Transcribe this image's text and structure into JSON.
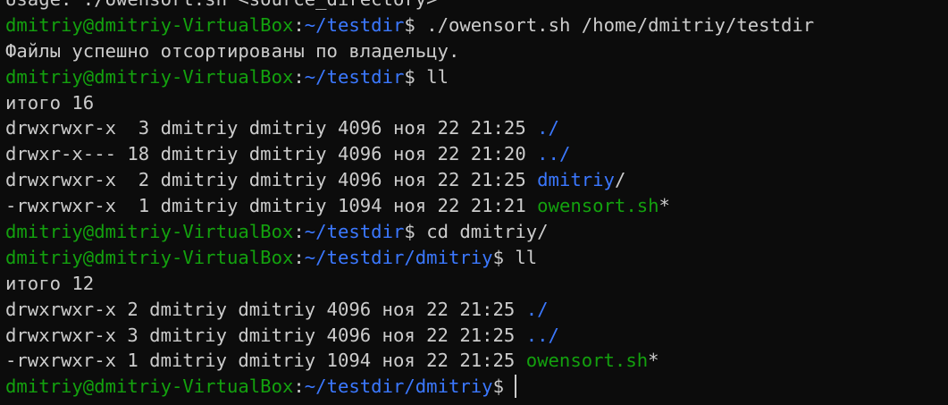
{
  "terminal": {
    "lines": [
      {
        "kind": "output",
        "text": "Usage: ./owensort.sh <source_directory>"
      },
      {
        "kind": "prompt",
        "user": "dmitriy@dmitriy-VirtualBox",
        "sep": ":",
        "path": "~/testdir",
        "dollar": "$ ",
        "command": "./owensort.sh /home/dmitriy/testdir"
      },
      {
        "kind": "output",
        "text": "Файлы успешно отсортированы по владельцу."
      },
      {
        "kind": "prompt",
        "user": "dmitriy@dmitriy-VirtualBox",
        "sep": ":",
        "path": "~/testdir",
        "dollar": "$ ",
        "command": "ll"
      },
      {
        "kind": "output",
        "text": "итого 16"
      },
      {
        "kind": "listing",
        "prefix": "drwxrwxr-x  3 dmitriy dmitriy 4096 ноя 22 21:25 ",
        "name": "./",
        "type": "dir",
        "suffix": ""
      },
      {
        "kind": "listing",
        "prefix": "drwxr-x--- 18 dmitriy dmitriy 4096 ноя 22 21:20 ",
        "name": "../",
        "type": "dir",
        "suffix": ""
      },
      {
        "kind": "listing",
        "prefix": "drwxrwxr-x  2 dmitriy dmitriy 4096 ноя 22 21:25 ",
        "name": "dmitriy",
        "type": "dir",
        "suffix": "/"
      },
      {
        "kind": "listing",
        "prefix": "-rwxrwxr-x  1 dmitriy dmitriy 1094 ноя 22 21:21 ",
        "name": "owensort.sh",
        "type": "exec",
        "suffix": "*"
      },
      {
        "kind": "prompt",
        "user": "dmitriy@dmitriy-VirtualBox",
        "sep": ":",
        "path": "~/testdir",
        "dollar": "$ ",
        "command": "cd dmitriy/"
      },
      {
        "kind": "prompt",
        "user": "dmitriy@dmitriy-VirtualBox",
        "sep": ":",
        "path": "~/testdir/dmitriy",
        "dollar": "$ ",
        "command": "ll"
      },
      {
        "kind": "output",
        "text": "итого 12"
      },
      {
        "kind": "listing",
        "prefix": "drwxrwxr-x 2 dmitriy dmitriy 4096 ноя 22 21:25 ",
        "name": "./",
        "type": "dir",
        "suffix": ""
      },
      {
        "kind": "listing",
        "prefix": "drwxrwxr-x 3 dmitriy dmitriy 4096 ноя 22 21:25 ",
        "name": "../",
        "type": "dir",
        "suffix": ""
      },
      {
        "kind": "listing",
        "prefix": "-rwxrwxr-x 1 dmitriy dmitriy 1094 ноя 22 21:25 ",
        "name": "owensort.sh",
        "type": "exec",
        "suffix": "*"
      },
      {
        "kind": "prompt",
        "user": "dmitriy@dmitriy-VirtualBox",
        "sep": ":",
        "path": "~/testdir/dmitriy",
        "dollar": "$",
        "command": "",
        "cursor": true
      }
    ]
  },
  "colors": {
    "background": "#0c0c0c",
    "foreground": "#cccccc",
    "prompt_user": "#13a10e",
    "prompt_path": "#3b78ff",
    "directory": "#3b78ff",
    "executable": "#13a10e"
  }
}
